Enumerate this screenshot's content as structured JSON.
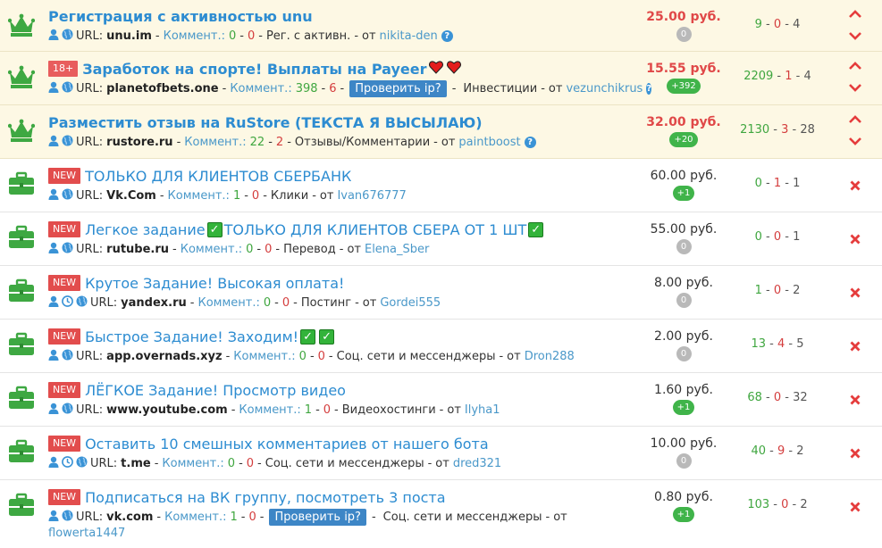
{
  "colors": {
    "link": "#2d8cd1",
    "price_red": "#e04848",
    "green": "#40b44a",
    "red": "#d43d3d",
    "pinned_bg": "#fdf8e4"
  },
  "common": {
    "url_label": "URL:",
    "comments_label": "Коммент.:",
    "from_label": "от",
    "currency": "руб.",
    "check_ip_label": "Проверить ip?",
    "new_label": "NEW",
    "age_label": "18+"
  },
  "rows": [
    {
      "pinned": true,
      "icon": "crown-icon",
      "title": "Регистрация с активностью unu",
      "domain": "unu.im",
      "comments": [
        "0",
        "0"
      ],
      "category": "Рег. с активн.",
      "author": "nikita-den",
      "help": true,
      "price": "25.00",
      "pill": "0",
      "stats": [
        "9",
        "0",
        "4"
      ]
    },
    {
      "pinned": true,
      "icon": "crown-icon",
      "age": true,
      "title": "Заработок на спорте! Выплаты на Payeer",
      "hearts": 2,
      "domain": "planetofbets.one",
      "comments": [
        "398",
        "6"
      ],
      "check_ip": true,
      "category": "Инвестиции",
      "author": "vezunchikrus",
      "help": true,
      "price": "15.55",
      "pill": "+392",
      "stats": [
        "2209",
        "1",
        "4"
      ]
    },
    {
      "pinned": true,
      "icon": "crown-icon",
      "title": "Разместить отзыв на RuStore (ТЕКСТА Я ВЫСЫЛАЮ)",
      "domain": "rustore.ru",
      "comments": [
        "22",
        "2"
      ],
      "category": "Отзывы/Комментарии",
      "author": "paintboost",
      "help": true,
      "price": "32.00",
      "pill": "+20",
      "stats": [
        "2130",
        "3",
        "28"
      ]
    },
    {
      "icon": "briefcase-icon",
      "new": true,
      "title": "ТОЛЬКО ДЛЯ КЛИЕНТОВ СБЕРБАНК",
      "domain": "Vk.Com",
      "comments": [
        "1",
        "0"
      ],
      "category": "Клики",
      "author": "Ivan676777",
      "price": "60.00",
      "pill": "+1",
      "stats": [
        "0",
        "1",
        "1"
      ]
    },
    {
      "icon": "briefcase-icon",
      "new": true,
      "title": "Легкое задание",
      "title_after": "ТОЛЬКО ДЛЯ КЛИЕНТОВ СБЕРА ОТ 1 ШТ",
      "checks_mid": 1,
      "checks_end": 1,
      "domain": "rutube.ru",
      "comments": [
        "0",
        "0"
      ],
      "category": "Перевод",
      "author": "Elena_Sber",
      "price": "55.00",
      "pill": "0",
      "stats": [
        "0",
        "0",
        "1"
      ]
    },
    {
      "icon": "briefcase-icon",
      "new": true,
      "clock": true,
      "title": "Крутое Задание! Высокая оплата!",
      "domain": "yandex.ru",
      "comments": [
        "0",
        "0"
      ],
      "category": "Постинг",
      "author": "Gordei555",
      "price": "8.00",
      "pill": "0",
      "stats": [
        "1",
        "0",
        "2"
      ]
    },
    {
      "icon": "briefcase-icon",
      "new": true,
      "title": "Быстрое Задание! Заходим!",
      "checks_end": 2,
      "domain": "app.overnads.xyz",
      "comments": [
        "0",
        "0"
      ],
      "category": "Соц. сети и мессенджеры",
      "author": "Dron288",
      "price": "2.00",
      "pill": "0",
      "stats": [
        "13",
        "4",
        "5"
      ]
    },
    {
      "icon": "briefcase-icon",
      "new": true,
      "title": "ЛЁГКОЕ Задание! Просмотр видео",
      "domain": "www.youtube.com",
      "comments": [
        "1",
        "0"
      ],
      "category": "Видеохостинги",
      "author": "Ilyha1",
      "price": "1.60",
      "pill": "+1",
      "stats": [
        "68",
        "0",
        "32"
      ]
    },
    {
      "icon": "briefcase-icon",
      "new": true,
      "clock": true,
      "title": "Оставить 10 смешных комментариев от нашего бота",
      "domain": "t.me",
      "comments": [
        "0",
        "0"
      ],
      "category": "Соц. сети и мессенджеры",
      "author": "dred321",
      "price": "10.00",
      "pill": "0",
      "stats": [
        "40",
        "9",
        "2"
      ]
    },
    {
      "icon": "briefcase-icon",
      "new": true,
      "title": "Подписаться на ВК группу, посмотреть 3 поста",
      "domain": "vk.com",
      "comments": [
        "1",
        "0"
      ],
      "check_ip": true,
      "category": "Соц. сети и мессенджеры",
      "author": "flowerta1447",
      "author_wrap": true,
      "price": "0.80",
      "pill": "+1",
      "stats": [
        "103",
        "0",
        "2"
      ]
    }
  ]
}
